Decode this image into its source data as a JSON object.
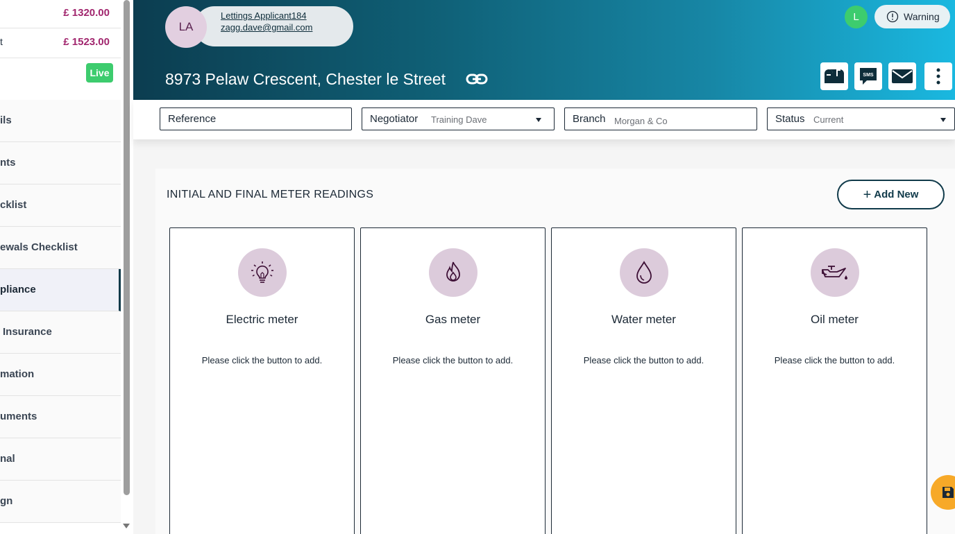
{
  "sidebar": {
    "prices": [
      {
        "label": "",
        "value": "£ 1320.00"
      },
      {
        "label": "t",
        "value": "£ 1523.00"
      }
    ],
    "status_badge": "Live",
    "items": [
      {
        "label": "ils"
      },
      {
        "label": "nts"
      },
      {
        "label": "cklist"
      },
      {
        "label": "ewals Checklist"
      },
      {
        "label": "pliance"
      },
      {
        "label": "Insurance"
      },
      {
        "label": "mation"
      },
      {
        "label": "uments"
      },
      {
        "label": "nal"
      },
      {
        "label": "gn"
      }
    ]
  },
  "header": {
    "avatar_initials": "LA",
    "applicant_name": "Lettings Applicant184",
    "applicant_email": "zagg.dave@gmail.com",
    "address": "8973 Pelaw Crescent, Chester le Street",
    "user_initial": "L",
    "warning_label": "Warning"
  },
  "fields": {
    "reference": {
      "label": "Reference",
      "value": ""
    },
    "negotiator": {
      "label": "Negotiator",
      "value": "Training Dave"
    },
    "branch": {
      "label": "Branch",
      "value": "Morgan & Co"
    },
    "status": {
      "label": "Status",
      "value": "Current"
    }
  },
  "section": {
    "title": "INITIAL AND FINAL METER READINGS",
    "add_button": "Add New"
  },
  "meters": [
    {
      "title": "Electric meter",
      "desc": "Please click the button to add.",
      "icon": "lightbulb-icon"
    },
    {
      "title": "Gas meter",
      "desc": "Please click the button to add.",
      "icon": "flame-icon"
    },
    {
      "title": "Water meter",
      "desc": "Please click the button to add.",
      "icon": "water-drop-icon"
    },
    {
      "title": "Oil meter",
      "desc": "Please click the button to add.",
      "icon": "oil-can-icon"
    }
  ],
  "colors": {
    "accent": "#103a4a",
    "price": "#a1266e",
    "live": "#3dcc6e",
    "icon_bg": "#dccbdb",
    "save_fab": "#f7a928"
  }
}
